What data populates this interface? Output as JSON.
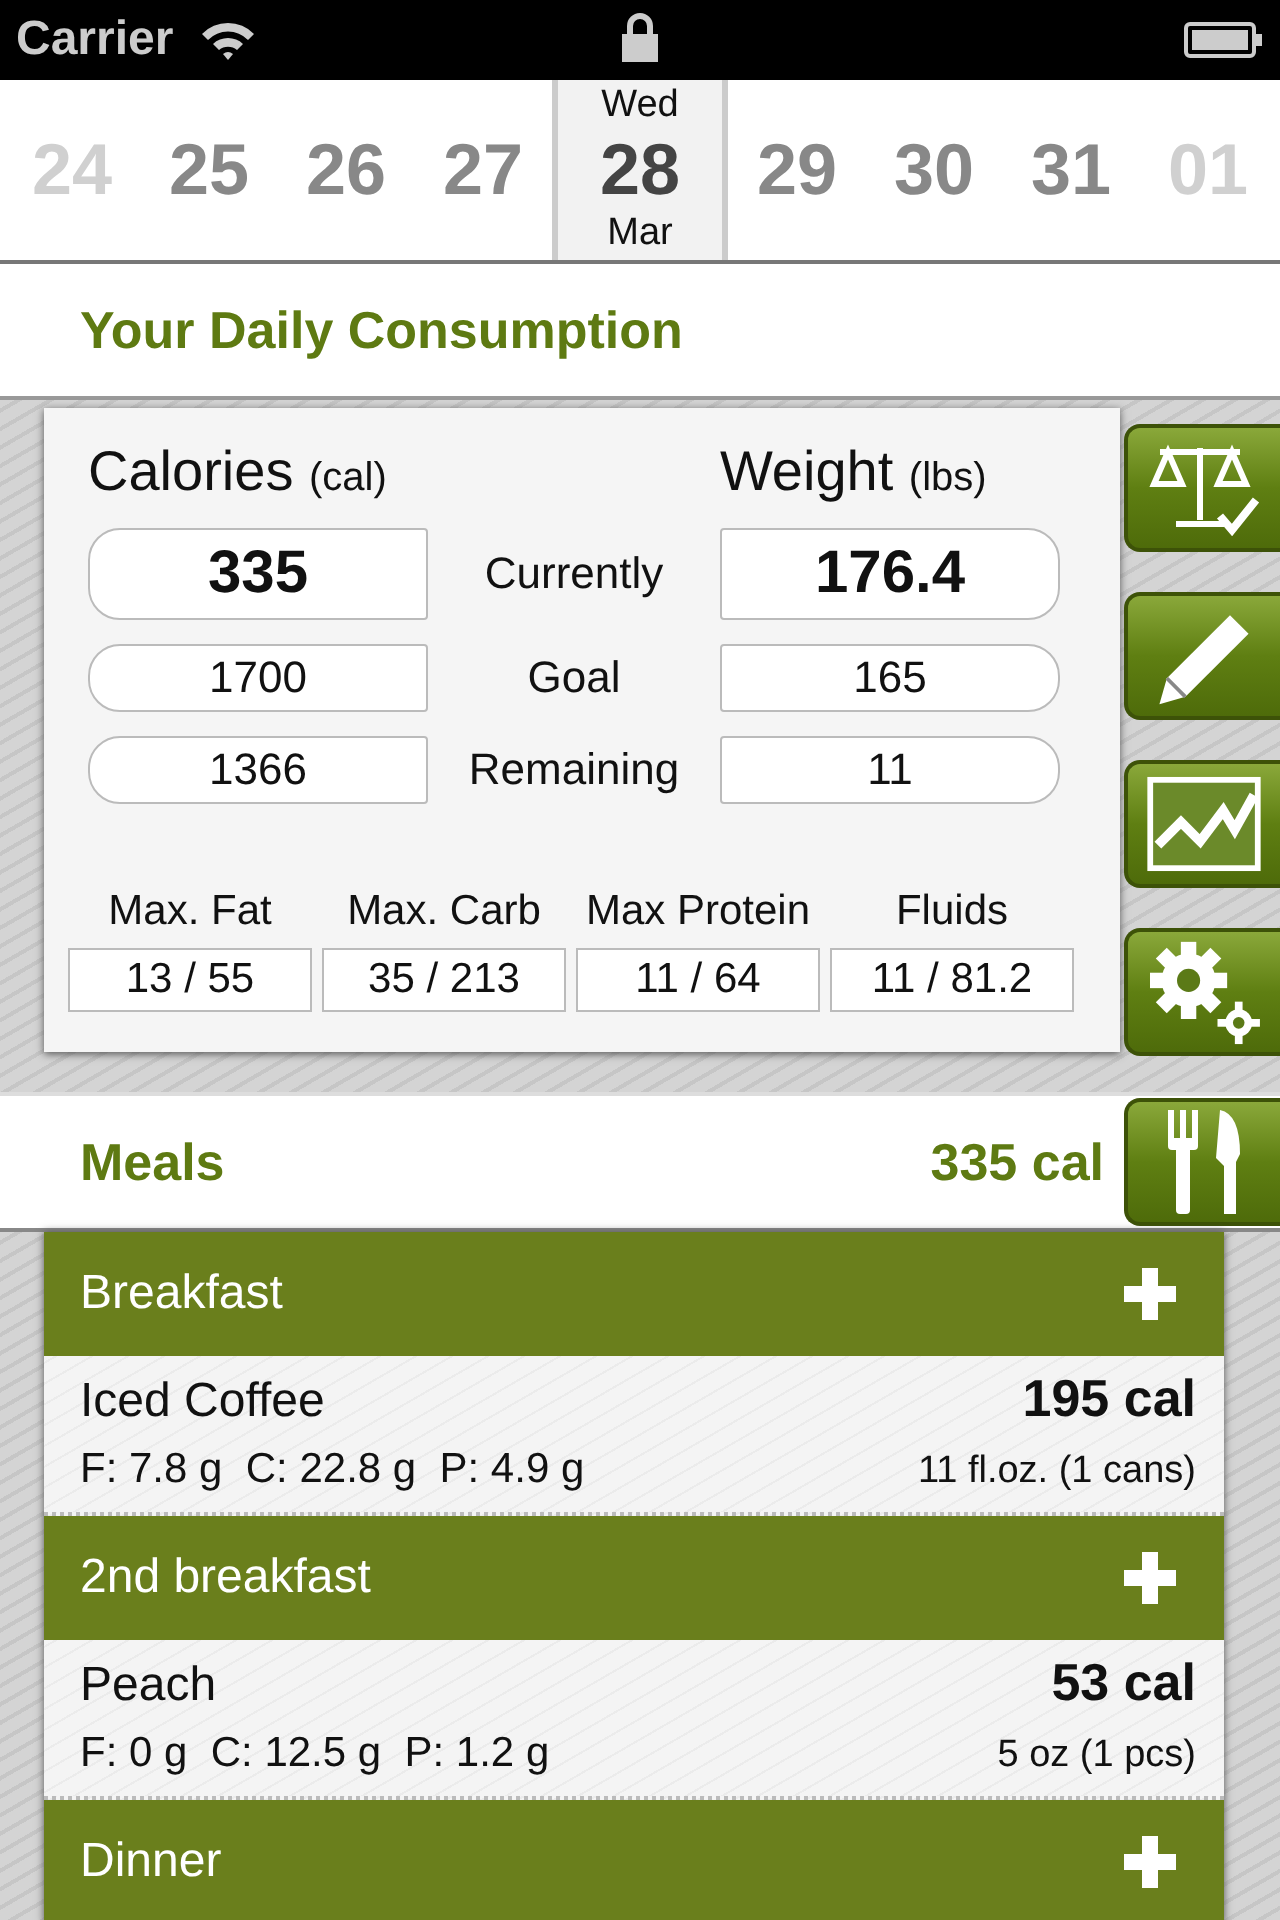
{
  "status_bar": {
    "carrier": "Carrier"
  },
  "date_strip": [
    {
      "day": "24",
      "selected": false,
      "faded": true
    },
    {
      "day": "25",
      "selected": false,
      "faded": false
    },
    {
      "day": "26",
      "selected": false,
      "faded": false
    },
    {
      "day": "27",
      "selected": false,
      "faded": false
    },
    {
      "day": "28",
      "weekday": "Wed",
      "month": "Mar",
      "selected": true,
      "faded": false
    },
    {
      "day": "29",
      "selected": false,
      "faded": false
    },
    {
      "day": "30",
      "selected": false,
      "faded": false
    },
    {
      "day": "31",
      "selected": false,
      "faded": false
    },
    {
      "day": "01",
      "selected": false,
      "faded": true
    }
  ],
  "section_title": "Your Daily Consumption",
  "summary": {
    "calories_label": "Calories",
    "calories_unit": "(cal)",
    "weight_label": "Weight",
    "weight_unit": "(lbs)",
    "rows": [
      {
        "label": "Currently",
        "calories": "335",
        "weight": "176.4",
        "kind": "primary"
      },
      {
        "label": "Goal",
        "calories": "1700",
        "weight": "165",
        "kind": "secondary"
      },
      {
        "label": "Remaining",
        "calories": "1366",
        "weight": "11",
        "kind": "secondary"
      }
    ],
    "macros": [
      {
        "label": "Max. Fat",
        "value": "13 / 55"
      },
      {
        "label": "Max. Carb",
        "value": "35 / 213"
      },
      {
        "label": "Max Protein",
        "value": "11 / 64"
      },
      {
        "label": "Fluids",
        "value": "11 / 81.2"
      }
    ]
  },
  "side_buttons": [
    {
      "kind": "scale"
    },
    {
      "kind": "edit"
    },
    {
      "kind": "chart"
    },
    {
      "kind": "settings"
    }
  ],
  "meals_bar": {
    "title": "Meals",
    "total": "335 cal"
  },
  "meals": [
    {
      "name": "Breakfast",
      "items": [
        {
          "name": "Iced Coffee",
          "calories": "195 cal",
          "macros": "F: 7.8 g  C: 22.8 g  P: 4.9 g",
          "portion": "11 fl.oz. (1 cans)"
        }
      ]
    },
    {
      "name": "2nd breakfast",
      "items": [
        {
          "name": "Peach",
          "calories": "53 cal",
          "macros": "F: 0 g  C: 12.5 g  P: 1.2 g",
          "portion": "5 oz (1 pcs)"
        }
      ]
    },
    {
      "name": "Dinner"
    }
  ]
}
